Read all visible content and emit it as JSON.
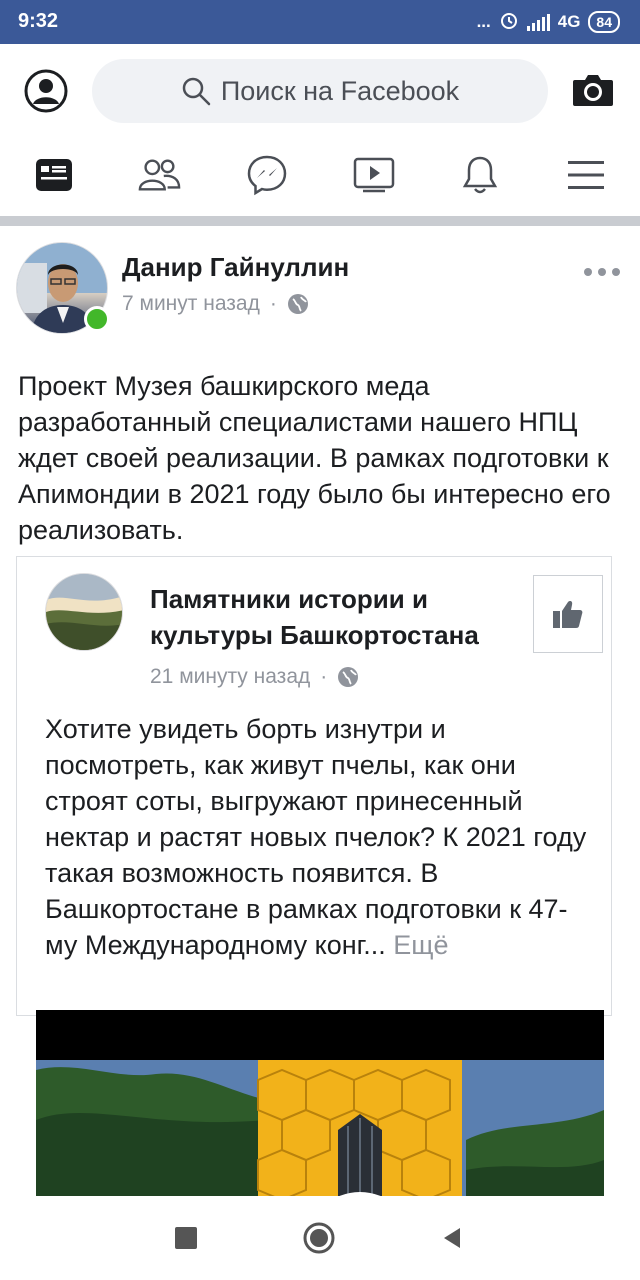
{
  "status_bar": {
    "time": "9:32",
    "dots": "...",
    "network": "4G",
    "battery": "84",
    "bg_color": "#3b5998"
  },
  "header": {
    "search_placeholder": "Поиск на Facebook",
    "icons": [
      "profile-icon",
      "search-icon",
      "camera-icon"
    ]
  },
  "nav_tabs": [
    {
      "name": "news-feed",
      "icon": "news-feed-icon",
      "active": true
    },
    {
      "name": "friends",
      "icon": "friends-icon"
    },
    {
      "name": "messenger",
      "icon": "messenger-icon"
    },
    {
      "name": "watch",
      "icon": "video-icon"
    },
    {
      "name": "notifications",
      "icon": "bell-icon"
    },
    {
      "name": "menu",
      "icon": "hamburger-icon"
    }
  ],
  "post": {
    "author": "Данир Гайнуллин",
    "time": "7 минут назад",
    "separator": "·",
    "privacy_icon": "globe-icon",
    "text": "Проект Музея  башкирского меда разработанный специалистами нашего НПЦ  ждет своей реализации. В рамках подготовки к Апимондии в 2021 году было бы интересно его реализовать.",
    "shared": {
      "page_name": "Памятники истории и культуры Башкортостана",
      "time": "21 минуту назад",
      "separator": "·",
      "text": "Хотите увидеть борть изнутри и посмотреть, как живут пчелы, как они строят соты, выгружают принесенный нектар и растят новых пчелок? К 2021 году такая возможность появится. В Башкортостане в рамках подготовки к 47-му Международному конг...",
      "see_more": "Ещё"
    }
  },
  "system_nav": [
    "recents-button",
    "home-button",
    "back-button"
  ],
  "colors": {
    "brand": "#3b5998",
    "online": "#42b72a",
    "meta_text": "#90949c",
    "honeycomb": "#f2b21a"
  }
}
